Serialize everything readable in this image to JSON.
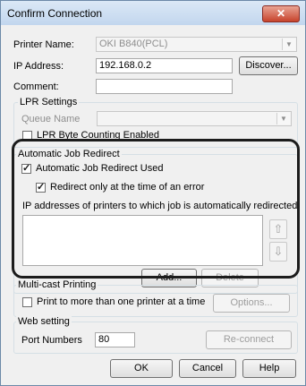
{
  "window": {
    "title": "Confirm Connection",
    "close_glyph": "✕"
  },
  "printer_name": {
    "label": "Printer Name:",
    "value": "OKI B840(PCL)"
  },
  "ip_address": {
    "label": "IP Address:",
    "value": "192.168.0.2",
    "discover_label": "Discover..."
  },
  "comment": {
    "label": "Comment:",
    "value": ""
  },
  "lpr": {
    "legend": "LPR Settings",
    "queue_label": "Queue Name",
    "queue_value": "",
    "byte_counting_label": "LPR Byte Counting Enabled",
    "byte_counting_checked": false
  },
  "redirect": {
    "legend": "Automatic Job Redirect",
    "used_label": "Automatic Job Redirect Used",
    "used_checked": true,
    "only_error_label": "Redirect only at the time of an error",
    "only_error_checked": true,
    "list_caption": "IP addresses of printers to which job is automatically redirected",
    "up_glyph": "⇧",
    "down_glyph": "⇩",
    "add_label": "Add...",
    "delete_label": "Delete"
  },
  "multicast": {
    "legend": "Multi-cast Printing",
    "print_label": "Print to more than one printer at a time",
    "print_checked": false,
    "options_label": "Options..."
  },
  "web": {
    "legend": "Web setting",
    "port_label": "Port Numbers",
    "port_value": "80",
    "reconnect_label": "Re-connect"
  },
  "footer": {
    "ok_label": "OK",
    "cancel_label": "Cancel",
    "help_label": "Help"
  },
  "colors": {
    "title_bar": "#c2d6ee",
    "close_button": "#c7432c",
    "highlight_border": "#1c1c1c"
  }
}
